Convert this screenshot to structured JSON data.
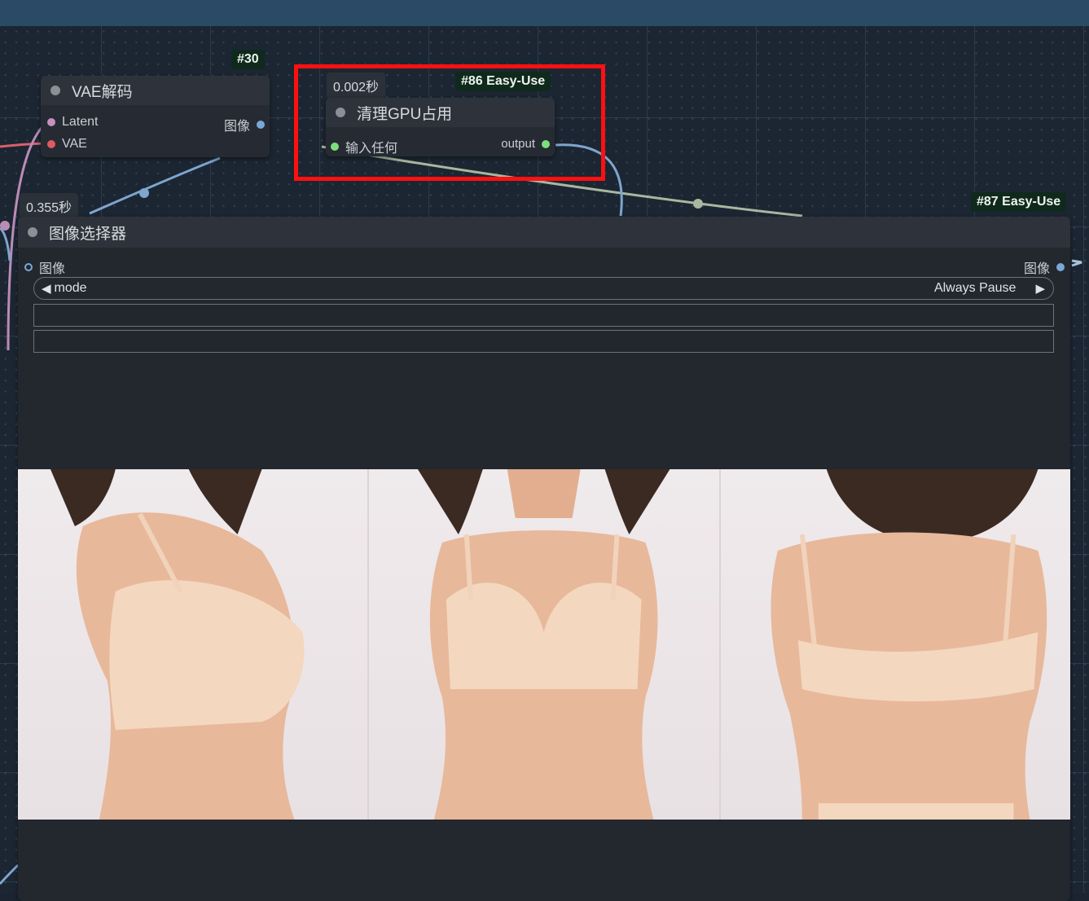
{
  "nodes": {
    "vae_decode": {
      "id_tag": "#30",
      "title": "VAE解码",
      "inputs": [
        "Latent",
        "VAE"
      ],
      "output": "图像"
    },
    "clean_gpu": {
      "timer": "0.002秒",
      "id_tag": "#86 Easy-Use",
      "title": "清理GPU占用",
      "input": "输入任何",
      "output": "output"
    },
    "image_selector": {
      "timer": "0.355秒",
      "id_tag": "#87 Easy-Use",
      "title": "图像选择器",
      "input": "图像",
      "output": "图像",
      "mode_label": "mode",
      "mode_value": "Always Pause",
      "widget_left_arrow": "◀",
      "widget_right_arrow": "▶"
    }
  },
  "colors": {
    "latent": "#c58fc0",
    "vae": "#e05a66",
    "image": "#7aa8d6",
    "any": "#7be07b",
    "highlight": "#ff1010"
  }
}
